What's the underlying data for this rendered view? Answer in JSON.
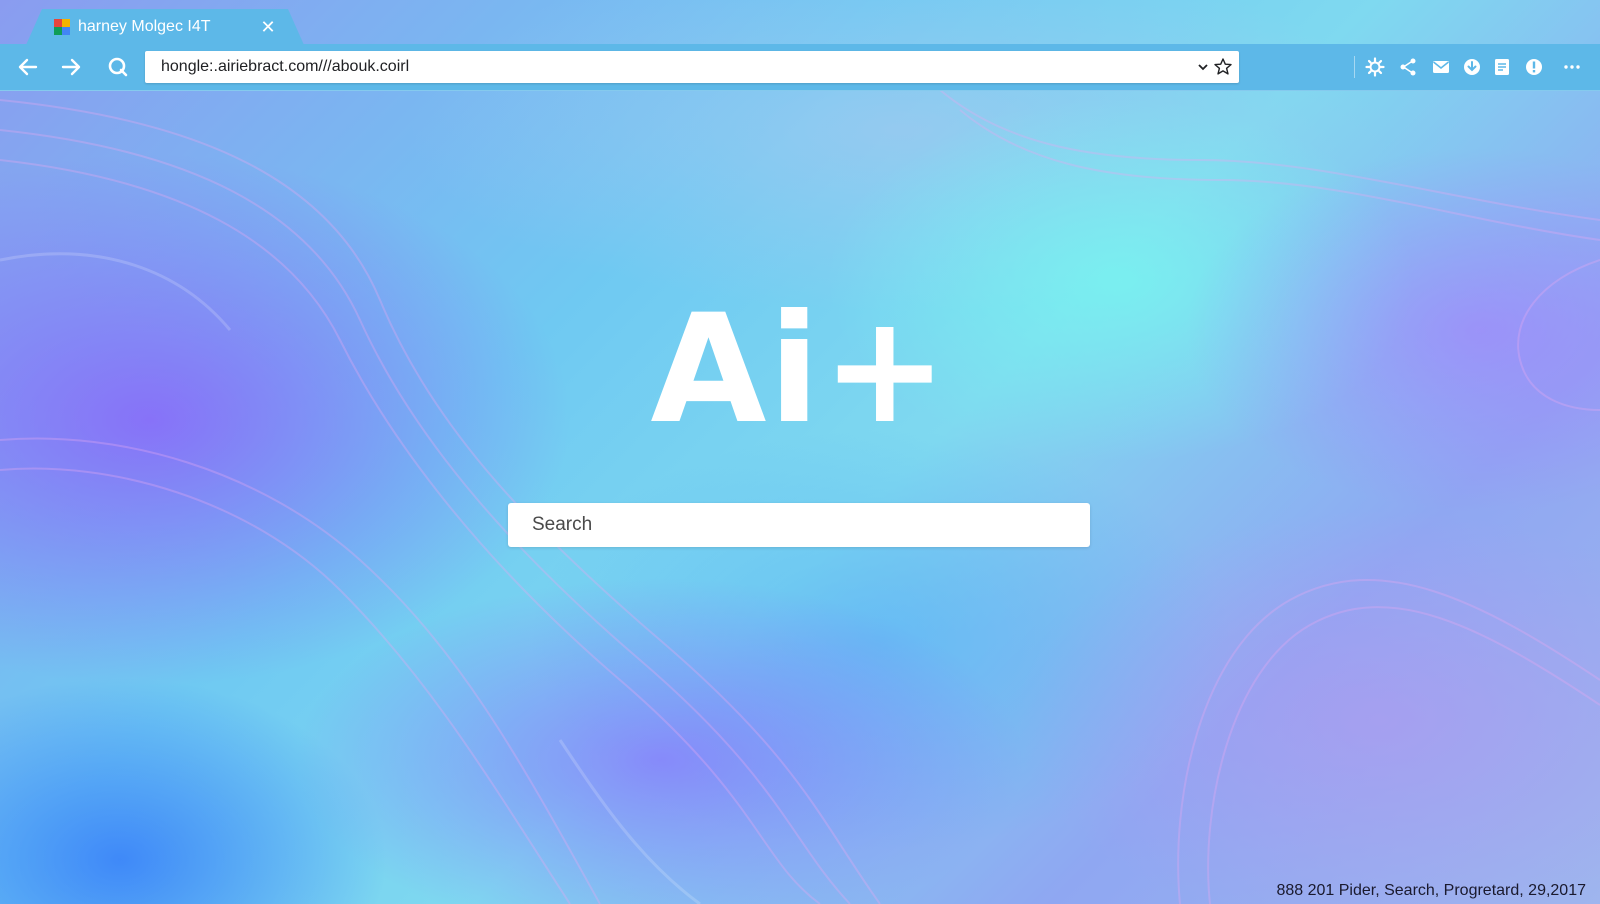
{
  "browser": {
    "tab": {
      "title": "harney Molgec I4T",
      "favicon": "colorful-favicon-icon",
      "close_icon": "close-icon"
    },
    "toolbar": {
      "back_icon": "back-arrow-icon",
      "forward_icon": "forward-arrow-icon",
      "reload_icon": "reload-icon",
      "address": "hongle:.airiebract.com///abouk.coirl",
      "address_dropdown_icon": "chevron-down-icon",
      "bookmark_icon": "star-icon",
      "extensions": [
        "settings-gear-icon",
        "share-icon",
        "mail-icon",
        "download-icon",
        "clipboard-icon",
        "info-icon",
        "more-icon"
      ]
    },
    "colors": {
      "chrome": "#5db8e8",
      "text_light": "#ffffff"
    }
  },
  "page": {
    "logo": "Ai+",
    "search": {
      "placeholder": "Search",
      "value": ""
    },
    "status_text": "888 201 Pider, Search, Progretard, 29,2017"
  }
}
